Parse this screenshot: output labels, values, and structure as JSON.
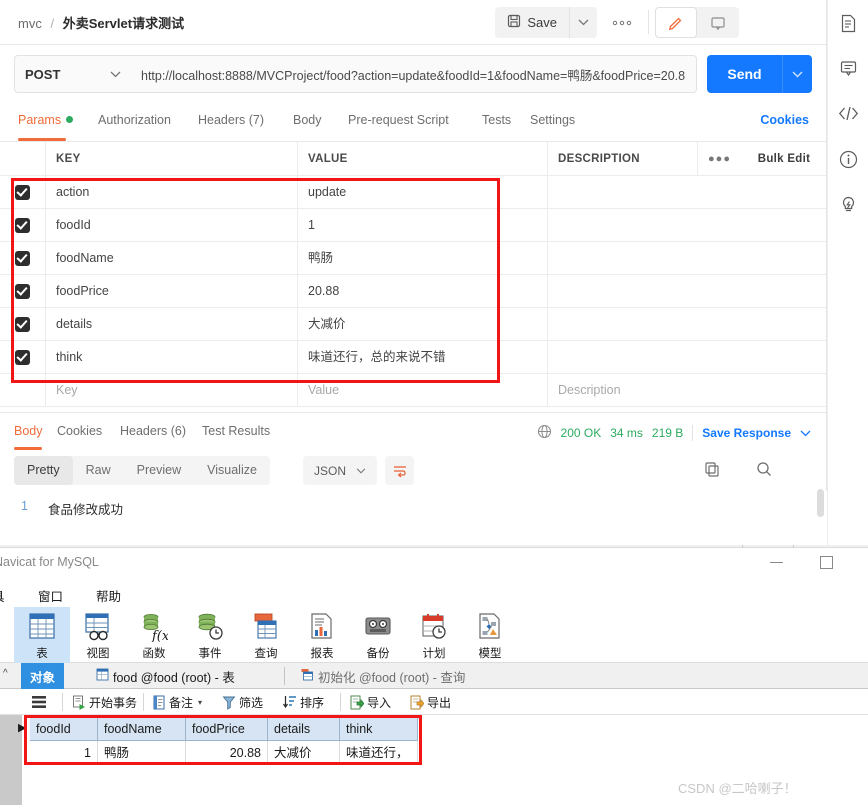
{
  "postman": {
    "breadcrumb": {
      "collection": "mvc",
      "separator": "/",
      "current": "外卖Servlet请求测试"
    },
    "toolbar": {
      "save_label": "Save",
      "more_label": "●●●"
    },
    "request": {
      "method": "POST",
      "url": "http://localhost:8888/MVCProject/food?action=update&foodId=1&foodName=鸭肠&foodPrice=20.8",
      "send_label": "Send"
    },
    "tabs": [
      {
        "label": "Params",
        "has_dot": true,
        "active": true
      },
      {
        "label": "Authorization",
        "active": false
      },
      {
        "label": "Headers (7)",
        "active": false
      },
      {
        "label": "Body",
        "active": false
      },
      {
        "label": "Pre-request Script",
        "active": false
      },
      {
        "label": "Tests",
        "active": false
      },
      {
        "label": "Settings",
        "active": false
      }
    ],
    "cookies_link": "Cookies",
    "params_table": {
      "headers": {
        "key": "KEY",
        "value": "VALUE",
        "description": "DESCRIPTION",
        "menu": "●●●",
        "bulk_edit": "Bulk Edit"
      },
      "rows": [
        {
          "checked": true,
          "key": "action",
          "value": "update",
          "description": ""
        },
        {
          "checked": true,
          "key": "foodId",
          "value": "1",
          "description": ""
        },
        {
          "checked": true,
          "key": "foodName",
          "value": "鸭肠",
          "description": ""
        },
        {
          "checked": true,
          "key": "foodPrice",
          "value": "20.88",
          "description": ""
        },
        {
          "checked": true,
          "key": "details",
          "value": "大减价",
          "description": ""
        },
        {
          "checked": true,
          "key": "think",
          "value": "味道还行，总的来说不错",
          "description": ""
        }
      ],
      "placeholder_row": {
        "key": "Key",
        "value": "Value",
        "description": "Description"
      }
    },
    "response": {
      "tabs": [
        {
          "label": "Body",
          "active": true
        },
        {
          "label": "Cookies",
          "active": false
        },
        {
          "label": "Headers (6)",
          "active": false
        },
        {
          "label": "Test Results",
          "active": false
        }
      ],
      "status": "200 OK",
      "time": "34 ms",
      "size": "219 B",
      "save_response": "Save Response",
      "view_modes": [
        {
          "label": "Pretty",
          "active": true
        },
        {
          "label": "Raw",
          "active": false
        },
        {
          "label": "Preview",
          "active": false
        },
        {
          "label": "Visualize",
          "active": false
        }
      ],
      "format": "JSON",
      "body_lines": [
        {
          "no": "1",
          "text": "食品修改成功"
        }
      ]
    }
  },
  "navicat": {
    "window_title": "Navicat for MySQL",
    "menu": [
      "具",
      "窗口",
      "帮助"
    ],
    "ribbon": [
      {
        "label": "表",
        "icon": "table-icon",
        "selected": true
      },
      {
        "label": "视图",
        "icon": "view-icon",
        "selected": false
      },
      {
        "label": "函数",
        "icon": "function-icon",
        "selected": false
      },
      {
        "label": "事件",
        "icon": "event-icon",
        "selected": false
      },
      {
        "label": "查询",
        "icon": "query-icon",
        "selected": false
      },
      {
        "label": "报表",
        "icon": "report-icon",
        "selected": false
      },
      {
        "label": "备份",
        "icon": "backup-icon",
        "selected": false
      },
      {
        "label": "计划",
        "icon": "schedule-icon",
        "selected": false
      },
      {
        "label": "模型",
        "icon": "model-icon",
        "selected": false
      }
    ],
    "tabs": [
      {
        "label": "对象",
        "active": true
      },
      {
        "label": "food @food (root) - 表",
        "active": false
      },
      {
        "label": "初始化 @food (root) - 查询",
        "active": false
      }
    ],
    "toolbar": [
      {
        "label": "",
        "icon": "hamburger-icon"
      },
      {
        "label": "开始事务",
        "icon": "begin-transaction-icon"
      },
      {
        "label": "备注",
        "icon": "note-icon",
        "caret": true
      },
      {
        "label": "筛选",
        "icon": "filter-icon"
      },
      {
        "label": "排序",
        "icon": "sort-icon"
      },
      {
        "label": "导入",
        "icon": "import-icon"
      },
      {
        "label": "导出",
        "icon": "export-icon"
      }
    ],
    "grid": {
      "headers": [
        "foodId",
        "foodName",
        "foodPrice",
        "details",
        "think"
      ],
      "rows": [
        [
          "1",
          "鸭肠",
          "20.88",
          "大减价",
          "味道还行，"
        ]
      ]
    }
  },
  "watermark": "CSDN @二哈喇子！"
}
